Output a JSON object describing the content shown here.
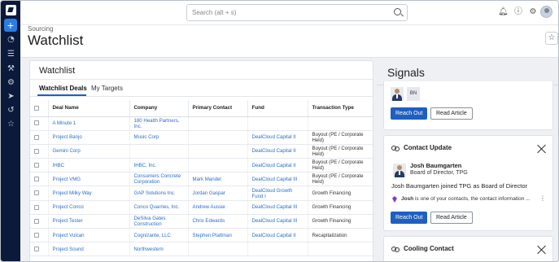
{
  "search": {
    "placeholder": "Search (alt + s)"
  },
  "header": {
    "breadcrumb": "Sourcing",
    "title": "Watchlist"
  },
  "watchlist": {
    "title": "Watchlist",
    "tabs": [
      "Watchlist Deals",
      "My Targets"
    ],
    "columns": [
      "Deal Name",
      "Company",
      "Primary Contact",
      "Fund",
      "Transaction Type"
    ],
    "rows": [
      {
        "deal": "A Minute 1",
        "company": "180 Health Partners, Inc.",
        "contact": "",
        "fund": "",
        "type": ""
      },
      {
        "deal": "Project Banjo",
        "company": "Music Corp",
        "contact": "",
        "fund": "DealCloud Capital II",
        "type": "Buyout (PE / Corporate Held)"
      },
      {
        "deal": "Gemini Corp",
        "company": "",
        "contact": "",
        "fund": "DealCloud Capital II",
        "type": "Buyout (PE / Corporate Held)"
      },
      {
        "deal": "IHBC",
        "company": "IHBC, Inc.",
        "contact": "",
        "fund": "DealCloud Capital II",
        "type": "Buyout (PE / Corporate Held)"
      },
      {
        "deal": "Project VMG",
        "company": "Consumers Concrete Corporation",
        "contact": "Mark Mandel",
        "fund": "DealCloud Capital III",
        "type": "Buyout (PE / Corporate Held)"
      },
      {
        "deal": "Project Milky Way",
        "company": "GAP Solutions Inc.",
        "contact": "Jordan Gaspar",
        "fund": "DealCloud Growth Fund I",
        "type": "Growth Financing"
      },
      {
        "deal": "Project Conco",
        "company": "Conco Quarries, Inc.",
        "contact": "Andrew Aussie",
        "fund": "DealCloud Capital III",
        "type": "Growth Financing"
      },
      {
        "deal": "Project Tester",
        "company": "DeSilva Gates Construction",
        "contact": "Chris Edwards",
        "fund": "DealCloud Capital III",
        "type": "Growth Financing"
      },
      {
        "deal": "Project Vulcan",
        "company": "Cognizante, LLC",
        "contact": "Stephen Plattman",
        "fund": "DealCloud Capital II",
        "type": "Recapitalization"
      },
      {
        "deal": "Project Sound",
        "company": "Northwestern",
        "contact": "",
        "fund": "",
        "type": ""
      }
    ]
  },
  "signals": {
    "title": "Signals",
    "card1": {
      "initials": "BN",
      "reach_out": "Reach Out",
      "read_article": "Read Article"
    },
    "card2": {
      "heading": "Contact Update",
      "name": "Josh Baumgarten",
      "role": "Board of Director, TPG",
      "message": "Josh Baumgarten joined TPG as Board of Director",
      "note_name": "Josh",
      "note_text": " is one of your contacts, the contact information ...",
      "reach_out": "Reach Out",
      "read_article": "Read Article"
    },
    "card3": {
      "heading": "Cooling Contact"
    }
  },
  "icons": {
    "rail": [
      "app-logo-icon",
      "add-icon",
      "dashboard-icon",
      "list-icon",
      "tools-icon",
      "settings-gear-icon",
      "send-icon",
      "history-icon",
      "star-icon"
    ],
    "top": [
      "bell-icon",
      "help-icon",
      "gear-icon",
      "user-avatar"
    ]
  },
  "colors": {
    "rail_bg": "#0b1a3a",
    "accent": "#1f5fbf",
    "link": "#2a6fc9",
    "add_button": "#2a7de1"
  }
}
